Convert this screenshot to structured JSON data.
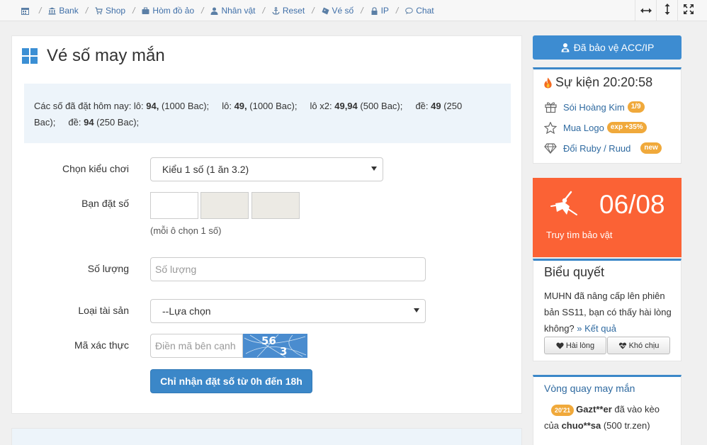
{
  "nav": {
    "items": [
      {
        "label": "",
        "icon": "calendar-icon"
      },
      {
        "label": "Bank",
        "icon": "bank-icon"
      },
      {
        "label": "Shop",
        "icon": "cart-icon"
      },
      {
        "label": "Hòm đồ ảo",
        "icon": "briefcase-icon"
      },
      {
        "label": "Nhân vật",
        "icon": "user-icon"
      },
      {
        "label": "Reset",
        "icon": "anchor-icon"
      },
      {
        "label": "Vé số",
        "icon": "ticket-icon"
      },
      {
        "label": "IP",
        "icon": "lock-icon"
      },
      {
        "label": "Chat",
        "icon": "chat-icon"
      }
    ],
    "tools": [
      "resize-horizontal-icon",
      "resize-vertical-icon",
      "fullscreen-icon"
    ]
  },
  "page": {
    "title": "Vé số may mắn",
    "info": {
      "prefix": "Các số đã đặt hôm nay: lô: ",
      "lo1_num": "94,",
      "lo1_cost": " (1000 Bac);",
      "lo2_label": "lô: ",
      "lo2_num": "49,",
      "lo2_cost": " (1000 Bac);",
      "lox2_label": "lô x2: ",
      "lox2_num": "49,94",
      "lox2_cost": " (500 Bac);",
      "de1_label": "đề: ",
      "de1_num": "49",
      "de1_cost": " (250",
      "line2_start": "Bac);",
      "de2_label": "đề: ",
      "de2_num": "94",
      "de2_cost": " (250 Bac);"
    },
    "form": {
      "play_type_label": "Chọn kiểu chơi",
      "play_type_value": "Kiểu 1 số (1 ăn 3.2)",
      "numbers_label": "Bạn đặt số",
      "numbers_hint": "(mỗi ô chọn 1 số)",
      "quantity_label": "Số lượng",
      "quantity_placeholder": "Số lượng",
      "asset_label": "Loại tài sản",
      "asset_value": "--Lựa chọn",
      "captcha_label": "Mã xác thực",
      "captcha_placeholder": "Điền mã bên cạnh",
      "captcha_text": "563",
      "submit_label": "Chỉ nhận đặt số từ 0h đến 18h"
    }
  },
  "sidebar": {
    "protect_label": "Đã bảo vệ ACC/IP",
    "event": {
      "title": "Sự kiện 20:20:58",
      "items": [
        {
          "label": "Sói Hoàng Kim",
          "badge": "1/9",
          "icon": "gift-icon"
        },
        {
          "label": "Mua Logo",
          "badge": "exp +35%",
          "icon": "star-icon"
        },
        {
          "label": "Đổi Ruby / Ruud",
          "badge": "new",
          "icon": "diamond-icon"
        }
      ]
    },
    "treasure": {
      "date": "06/08",
      "label": "Truy tìm bảo vật"
    },
    "poll": {
      "title": "Biểu quyết",
      "text": "MUHN đã nâng cấp lên phiên bản SS11, bạn có thấy hài lòng không?",
      "link": "» Kết quả",
      "yes": "Hài lòng",
      "no": "Khó chịu"
    },
    "spin": {
      "title": "Vòng quay may mắn",
      "badge": "20'21",
      "user": "Gazt**er",
      "mid": " đã vào kèo của ",
      "target": "chuo**sa",
      "tail": " (500 tr.zen)"
    }
  },
  "colors": {
    "accent": "#3b87c8",
    "treasure": "#fb6235",
    "badge": "#f0a93b"
  }
}
